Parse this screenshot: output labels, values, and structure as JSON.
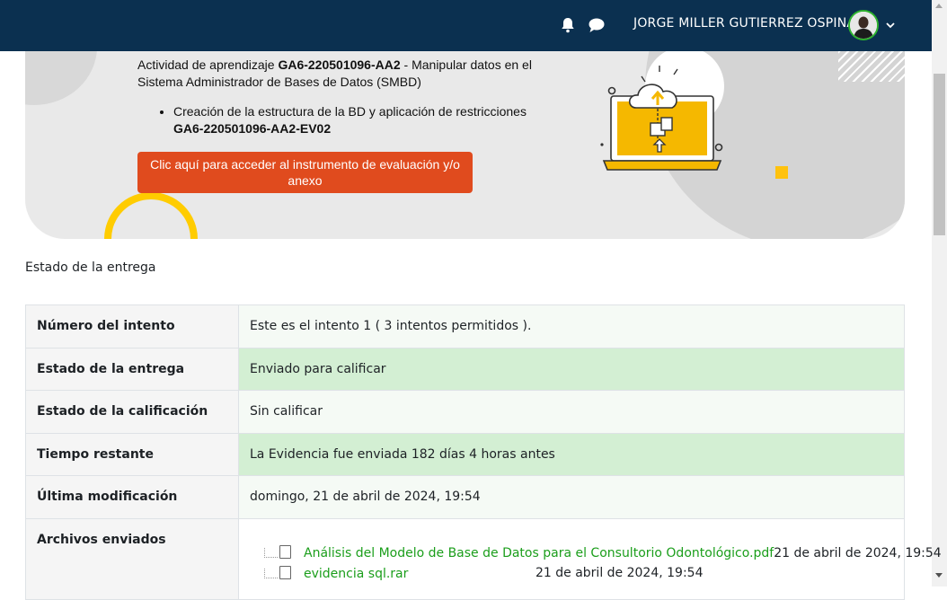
{
  "header": {
    "username": "JORGE MILLER GUTIERREZ OSPINA",
    "icons": [
      "bell-icon",
      "chat-icon",
      "avatar",
      "chevron-down-icon"
    ],
    "bg_color": "#0b3050"
  },
  "hero": {
    "activity_prefix": "Actividad de aprendizaje ",
    "activity_code": "GA6-220501096-AA2",
    "activity_suffix": " - Manipular datos en el Sistema Administrador de Bases de Datos (SMBD)",
    "bullet_text": "Creación de la estructura de la BD y aplicación de restricciones",
    "bullet_code": "GA6-220501096-AA2-EV02",
    "cta_label": "Clic aquí para acceder al instrumento de evaluación y/o anexo",
    "cta_color": "#e04b1e",
    "accent_yellow": "#ffcc00"
  },
  "section_title": "Estado de la entrega",
  "status_table": {
    "rows": [
      {
        "label": "Número del intento",
        "value": "Este es el intento 1 ( 3 intentos permitidos ).",
        "style": "plain"
      },
      {
        "label": "Estado de la entrega",
        "value": "Enviado para calificar",
        "style": "green"
      },
      {
        "label": "Estado de la calificación",
        "value": "Sin calificar",
        "style": "plain"
      },
      {
        "label": "Tiempo restante",
        "value": "La Evidencia fue enviada 182 días 4 horas antes",
        "style": "green"
      },
      {
        "label": "Última modificación",
        "value": "domingo, 21 de abril de 2024, 19:54",
        "style": "plain"
      }
    ],
    "files_label": "Archivos enviados",
    "files": [
      {
        "name": "Análisis del Modelo de Base de Datos para el Consultorio Odontológico.pdf",
        "date": "21 de abril de 2024, 19:54"
      },
      {
        "name": "evidencia sql.rar",
        "date": "21 de abril de 2024, 19:54"
      }
    ]
  }
}
